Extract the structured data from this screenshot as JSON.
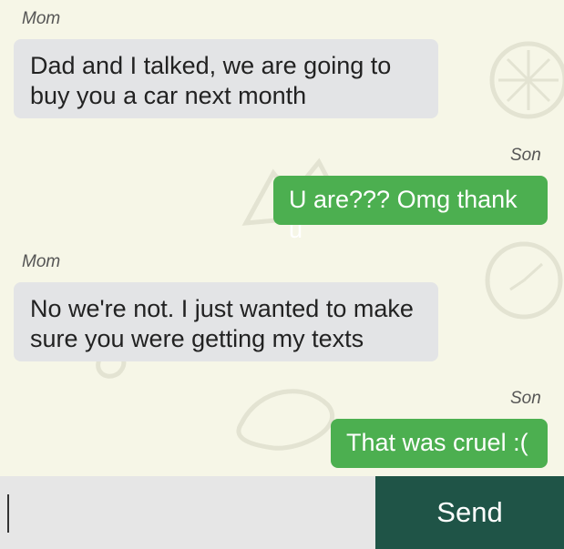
{
  "theme": {
    "background": "#f6f6e7",
    "incoming_bubble": "#e3e4e6",
    "outgoing_bubble": "#4caf50",
    "send_button": "#1f5447"
  },
  "messages": [
    {
      "sender": "Mom",
      "text_lines": [
        "Dad and I talked, we are going to",
        "buy you a car next month"
      ],
      "direction": "incoming"
    },
    {
      "sender": "Son",
      "text_lines": [
        "U are??? Omg thank u"
      ],
      "direction": "outgoing"
    },
    {
      "sender": "Mom",
      "text_lines": [
        "No we're not. I just wanted to make",
        "sure you were getting my texts"
      ],
      "direction": "incoming"
    },
    {
      "sender": "Son",
      "text_lines": [
        "That was cruel :("
      ],
      "direction": "outgoing"
    }
  ],
  "composer": {
    "input_value": "",
    "send_label": "Send"
  }
}
